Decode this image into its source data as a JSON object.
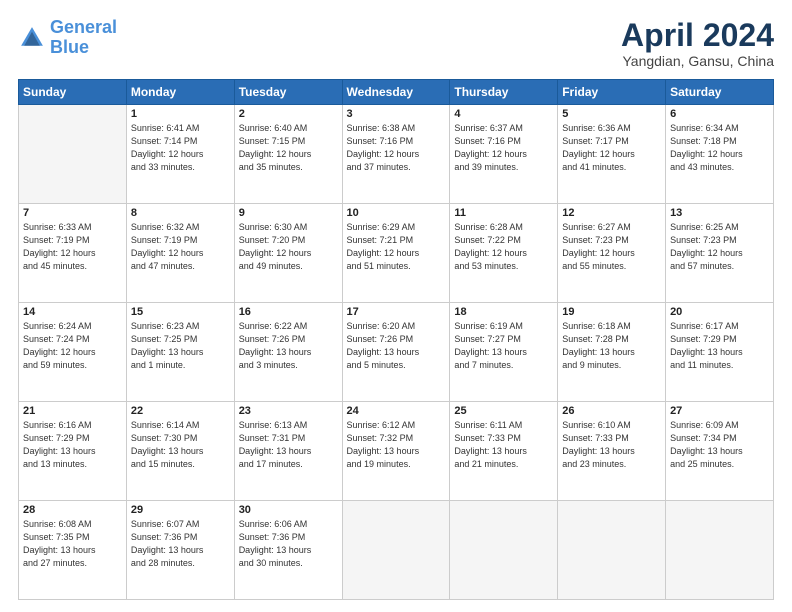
{
  "header": {
    "logo_line1": "General",
    "logo_line2": "Blue",
    "title": "April 2024",
    "location": "Yangdian, Gansu, China"
  },
  "weekdays": [
    "Sunday",
    "Monday",
    "Tuesday",
    "Wednesday",
    "Thursday",
    "Friday",
    "Saturday"
  ],
  "weeks": [
    [
      {
        "num": "",
        "info": ""
      },
      {
        "num": "1",
        "info": "Sunrise: 6:41 AM\nSunset: 7:14 PM\nDaylight: 12 hours\nand 33 minutes."
      },
      {
        "num": "2",
        "info": "Sunrise: 6:40 AM\nSunset: 7:15 PM\nDaylight: 12 hours\nand 35 minutes."
      },
      {
        "num": "3",
        "info": "Sunrise: 6:38 AM\nSunset: 7:16 PM\nDaylight: 12 hours\nand 37 minutes."
      },
      {
        "num": "4",
        "info": "Sunrise: 6:37 AM\nSunset: 7:16 PM\nDaylight: 12 hours\nand 39 minutes."
      },
      {
        "num": "5",
        "info": "Sunrise: 6:36 AM\nSunset: 7:17 PM\nDaylight: 12 hours\nand 41 minutes."
      },
      {
        "num": "6",
        "info": "Sunrise: 6:34 AM\nSunset: 7:18 PM\nDaylight: 12 hours\nand 43 minutes."
      }
    ],
    [
      {
        "num": "7",
        "info": "Sunrise: 6:33 AM\nSunset: 7:19 PM\nDaylight: 12 hours\nand 45 minutes."
      },
      {
        "num": "8",
        "info": "Sunrise: 6:32 AM\nSunset: 7:19 PM\nDaylight: 12 hours\nand 47 minutes."
      },
      {
        "num": "9",
        "info": "Sunrise: 6:30 AM\nSunset: 7:20 PM\nDaylight: 12 hours\nand 49 minutes."
      },
      {
        "num": "10",
        "info": "Sunrise: 6:29 AM\nSunset: 7:21 PM\nDaylight: 12 hours\nand 51 minutes."
      },
      {
        "num": "11",
        "info": "Sunrise: 6:28 AM\nSunset: 7:22 PM\nDaylight: 12 hours\nand 53 minutes."
      },
      {
        "num": "12",
        "info": "Sunrise: 6:27 AM\nSunset: 7:23 PM\nDaylight: 12 hours\nand 55 minutes."
      },
      {
        "num": "13",
        "info": "Sunrise: 6:25 AM\nSunset: 7:23 PM\nDaylight: 12 hours\nand 57 minutes."
      }
    ],
    [
      {
        "num": "14",
        "info": "Sunrise: 6:24 AM\nSunset: 7:24 PM\nDaylight: 12 hours\nand 59 minutes."
      },
      {
        "num": "15",
        "info": "Sunrise: 6:23 AM\nSunset: 7:25 PM\nDaylight: 13 hours\nand 1 minute."
      },
      {
        "num": "16",
        "info": "Sunrise: 6:22 AM\nSunset: 7:26 PM\nDaylight: 13 hours\nand 3 minutes."
      },
      {
        "num": "17",
        "info": "Sunrise: 6:20 AM\nSunset: 7:26 PM\nDaylight: 13 hours\nand 5 minutes."
      },
      {
        "num": "18",
        "info": "Sunrise: 6:19 AM\nSunset: 7:27 PM\nDaylight: 13 hours\nand 7 minutes."
      },
      {
        "num": "19",
        "info": "Sunrise: 6:18 AM\nSunset: 7:28 PM\nDaylight: 13 hours\nand 9 minutes."
      },
      {
        "num": "20",
        "info": "Sunrise: 6:17 AM\nSunset: 7:29 PM\nDaylight: 13 hours\nand 11 minutes."
      }
    ],
    [
      {
        "num": "21",
        "info": "Sunrise: 6:16 AM\nSunset: 7:29 PM\nDaylight: 13 hours\nand 13 minutes."
      },
      {
        "num": "22",
        "info": "Sunrise: 6:14 AM\nSunset: 7:30 PM\nDaylight: 13 hours\nand 15 minutes."
      },
      {
        "num": "23",
        "info": "Sunrise: 6:13 AM\nSunset: 7:31 PM\nDaylight: 13 hours\nand 17 minutes."
      },
      {
        "num": "24",
        "info": "Sunrise: 6:12 AM\nSunset: 7:32 PM\nDaylight: 13 hours\nand 19 minutes."
      },
      {
        "num": "25",
        "info": "Sunrise: 6:11 AM\nSunset: 7:33 PM\nDaylight: 13 hours\nand 21 minutes."
      },
      {
        "num": "26",
        "info": "Sunrise: 6:10 AM\nSunset: 7:33 PM\nDaylight: 13 hours\nand 23 minutes."
      },
      {
        "num": "27",
        "info": "Sunrise: 6:09 AM\nSunset: 7:34 PM\nDaylight: 13 hours\nand 25 minutes."
      }
    ],
    [
      {
        "num": "28",
        "info": "Sunrise: 6:08 AM\nSunset: 7:35 PM\nDaylight: 13 hours\nand 27 minutes."
      },
      {
        "num": "29",
        "info": "Sunrise: 6:07 AM\nSunset: 7:36 PM\nDaylight: 13 hours\nand 28 minutes."
      },
      {
        "num": "30",
        "info": "Sunrise: 6:06 AM\nSunset: 7:36 PM\nDaylight: 13 hours\nand 30 minutes."
      },
      {
        "num": "",
        "info": ""
      },
      {
        "num": "",
        "info": ""
      },
      {
        "num": "",
        "info": ""
      },
      {
        "num": "",
        "info": ""
      }
    ]
  ]
}
